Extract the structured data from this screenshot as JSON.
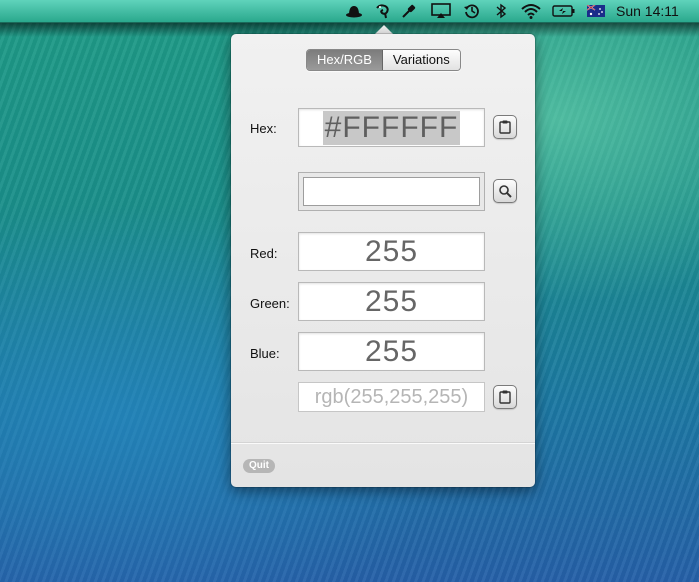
{
  "menubar": {
    "clock": "Sun 14:11"
  },
  "tabs": {
    "hex_rgb": "Hex/RGB",
    "variations": "Variations"
  },
  "labels": {
    "hex": "Hex:",
    "red": "Red:",
    "green": "Green:",
    "blue": "Blue:"
  },
  "values": {
    "hex": "#FFFFFF",
    "red": "255",
    "green": "255",
    "blue": "255",
    "rgb_string": "rgb(255,255,255)",
    "search": ""
  },
  "footer": {
    "quit": "Quit"
  },
  "icons": [
    "bowler-hat-icon",
    "chameleon-icon",
    "dropper-icon",
    "airplay-icon",
    "time-machine-icon",
    "bluetooth-icon",
    "wifi-icon",
    "battery-icon",
    "flag-icon",
    "clipboard-icon",
    "search-icon"
  ],
  "colors": {
    "accent_selected_tab": "#8a8a8a",
    "hex_selection": "#c8c8c8"
  }
}
